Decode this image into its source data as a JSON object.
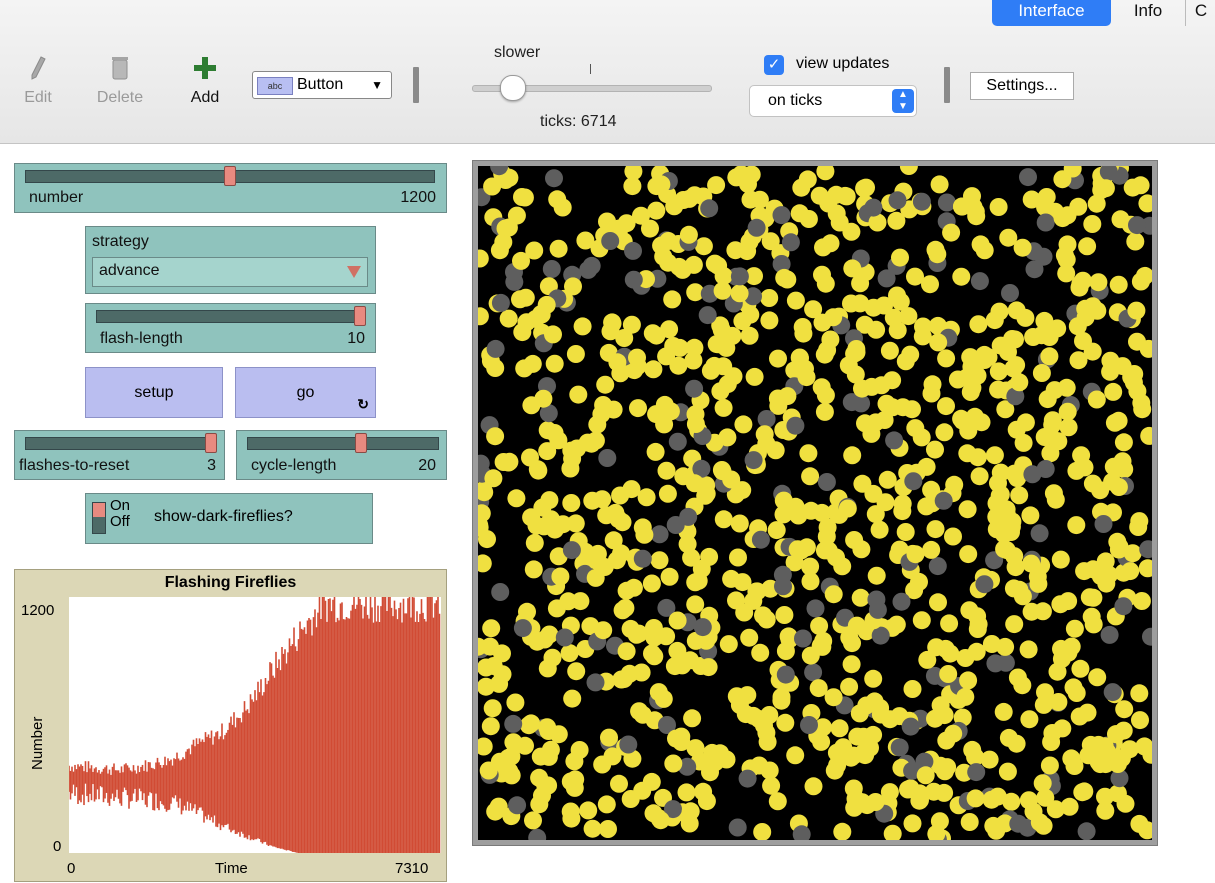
{
  "tabs": [
    "Interface",
    "Info",
    "C"
  ],
  "toolbar": {
    "edit_label": "Edit",
    "delete_label": "Delete",
    "add_label": "Add",
    "add_icon": "plus-icon",
    "widget_type": "Button",
    "widget_icon_text": "abc",
    "speed_label": "slower",
    "ticks_label": "ticks: 6714",
    "view_updates_label": "view updates",
    "view_updates_checked": true,
    "update_mode": "on ticks",
    "settings_label": "Settings..."
  },
  "sliders": {
    "number": {
      "label": "number",
      "value": "1200",
      "fraction": 0.5
    },
    "flash_length": {
      "label": "flash-length",
      "value": "10",
      "fraction": 1.0
    },
    "flashes_to_reset": {
      "label": "flashes-to-reset",
      "value": "3",
      "fraction": 1.0
    },
    "cycle_length": {
      "label": "cycle-length",
      "value": "20",
      "fraction": 0.6
    }
  },
  "chooser": {
    "label": "strategy",
    "value": "advance"
  },
  "buttons": {
    "setup": "setup",
    "go": "go",
    "go_forever_icon": "forever-icon"
  },
  "switch": {
    "on": "On",
    "off": "Off",
    "label": "show-dark-fireflies?"
  },
  "plot": {
    "title": "Flashing Fireflies",
    "xlabel": "Time",
    "ylabel": "Number",
    "xmin": "0",
    "xmax": "7310",
    "ymin": "0",
    "ymax": "1200"
  },
  "chart_data": {
    "type": "area",
    "title": "Flashing Fireflies",
    "xlabel": "Time",
    "ylabel": "Number",
    "xlim": [
      0,
      7310
    ],
    "ylim": [
      0,
      1200
    ],
    "series": [
      {
        "color": "#d14b34",
        "x": [
          0,
          500,
          1000,
          1500,
          2000,
          2500,
          3000,
          3500,
          4000,
          4500,
          5000,
          5500,
          6000,
          6500,
          7000,
          7310
        ],
        "high": [
          420,
          410,
          400,
          420,
          450,
          520,
          580,
          700,
          880,
          1050,
          1200,
          1200,
          1200,
          1200,
          1200,
          1200
        ],
        "low": [
          280,
          270,
          260,
          250,
          240,
          190,
          130,
          80,
          30,
          0,
          0,
          0,
          0,
          0,
          0,
          0
        ]
      }
    ]
  },
  "colors": {
    "widget_teal": "#8fc3bd",
    "button_purple": "#babef0",
    "plot_bg": "#dcd7b6",
    "plot_series": "#d14b34",
    "firefly_lit": "#f0e040",
    "firefly_dark": "#5e5e5e",
    "world_bg": "#000000",
    "tab_active": "#2f7df6"
  },
  "world": {
    "lit_fraction": 0.86,
    "firefly_count": 1200
  }
}
